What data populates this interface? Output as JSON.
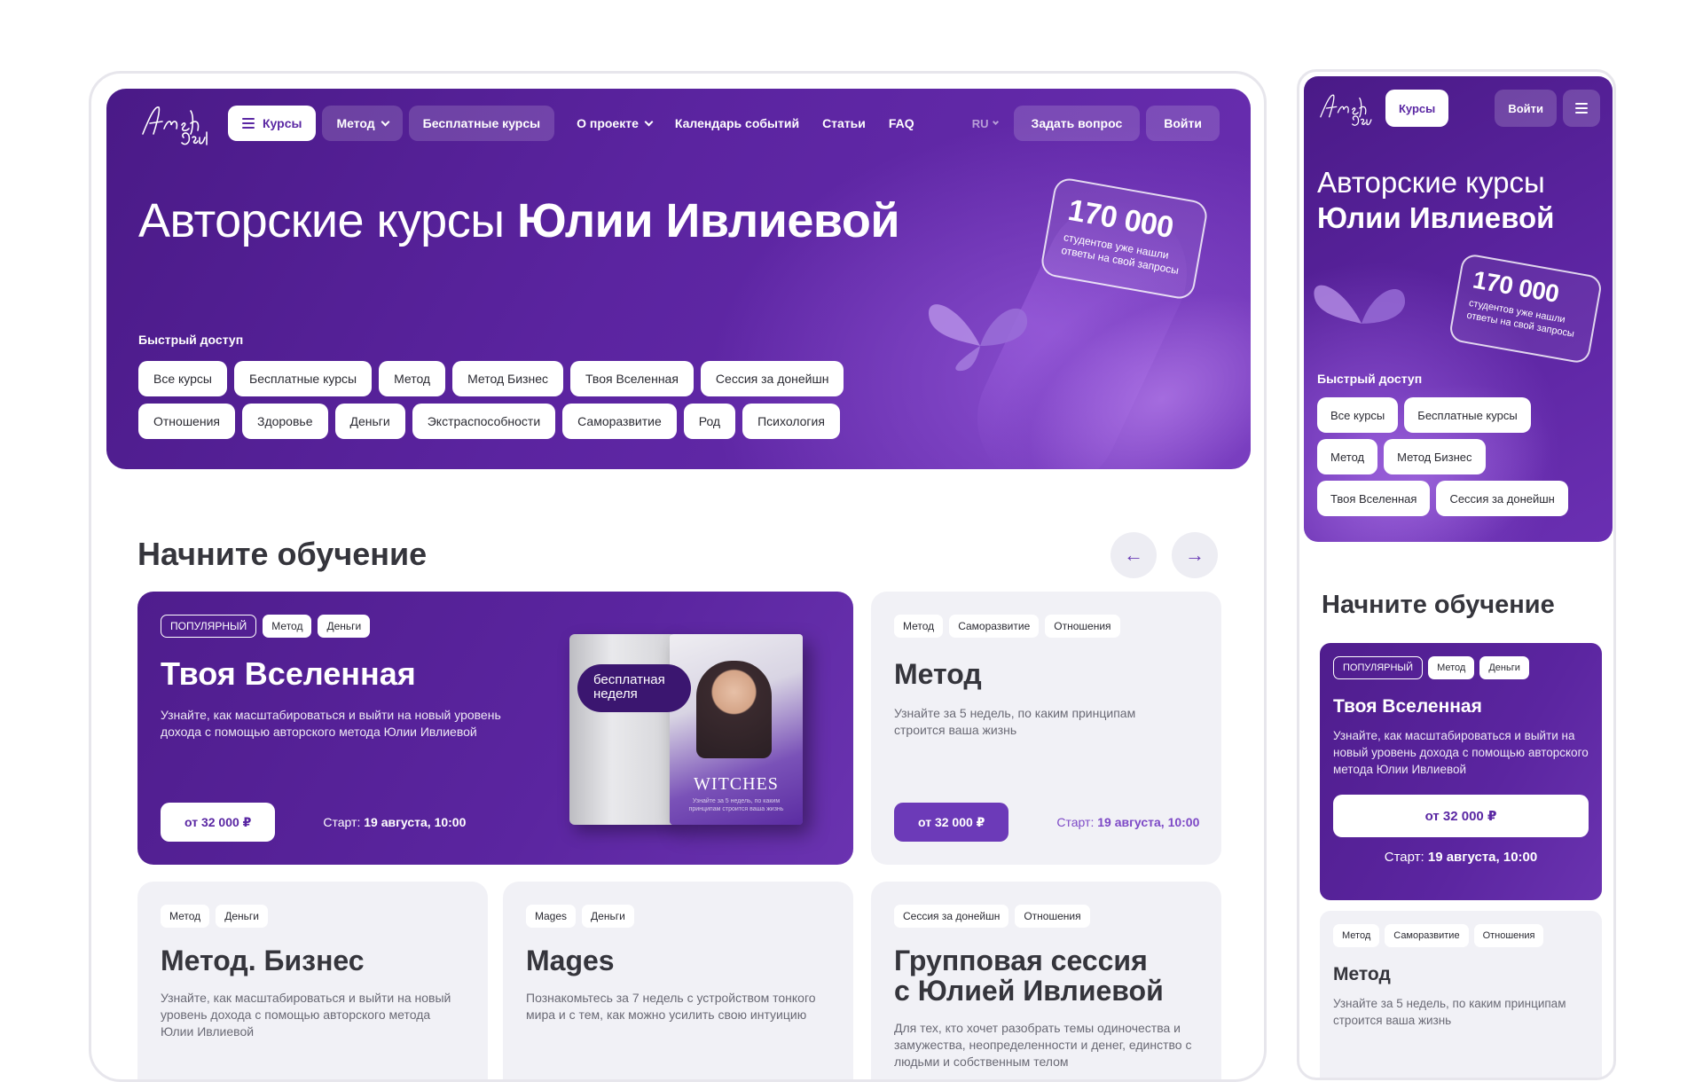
{
  "brand": {
    "logo_text": "Amsh Soul",
    "accent": "#5b24a0",
    "accent_light": "#7d49c6"
  },
  "nav": {
    "courses": "Курсы",
    "method": "Метод",
    "free_courses": "Бесплатные курсы",
    "about": "О проекте",
    "calendar": "Календарь событий",
    "articles": "Статьи",
    "faq": "FAQ",
    "lang": "RU",
    "ask": "Задать вопрос",
    "login": "Войти"
  },
  "hero": {
    "title_light": "Авторские курсы ",
    "title_bold": "Юлии Ивлиевой",
    "stat_number": "170 000",
    "stat_text": "студентов уже нашли ответы на свой запросы",
    "quick_access_label": "Быстрый доступ",
    "chips_row1": [
      "Все курсы",
      "Бесплатные курсы",
      "Метод",
      "Метод Бизнес",
      "Твоя Вселенная",
      "Сессия за донейшн"
    ],
    "chips_row2": [
      "Отношения",
      "Здоровье",
      "Деньги",
      "Экстраспособности",
      "Саморазвитие",
      "Род",
      "Психология"
    ]
  },
  "section": {
    "title": "Начните обучение",
    "prev_icon": "←",
    "next_icon": "→"
  },
  "cards": {
    "featured": {
      "badge": "ПОПУЛЯРНЫЙ",
      "tags": [
        "Метод",
        "Деньги"
      ],
      "title": "Твоя Вселенная",
      "desc": "Узнайте, как масштабироваться и выйти на новый уровень дохода с помощью авторского метода Юлии Ивлиевой",
      "price": "от 32 000 ₽",
      "start_label": "Старт: ",
      "start_value": "19 августа, 10:00",
      "book_badge": "бесплатная неделя",
      "book_title": "WITCHES",
      "book_caption": "Узнайте за 5 недель, по каким принципам строится ваша жизнь"
    },
    "method": {
      "tags": [
        "Метод",
        "Саморазвитие",
        "Отношения"
      ],
      "title": "Метод",
      "desc": "Узнайте за 5 недель, по каким принципам строится ваша жизнь",
      "price": "от 32 000 ₽",
      "start_label": "Старт: ",
      "start_value": "19 августа, 10:00"
    },
    "method_business": {
      "tags": [
        "Метод",
        "Деньги"
      ],
      "title": "Метод. Бизнес",
      "desc": "Узнайте, как масштабироваться и выйти на новый уровень дохода с помощью авторского метода Юлии Ивлиевой"
    },
    "mages": {
      "tags": [
        "Mages",
        "Деньги"
      ],
      "title": "Mages",
      "desc": "Познакомьтесь за 7 недель с устройством тонкого мира и с тем, как можно усилить свою интуицию"
    },
    "group_session": {
      "tags": [
        "Сессия за донейшн",
        "Отношения"
      ],
      "title_line1": "Групповая сессия",
      "title_line2": "с Юлией Ивлиевой",
      "desc": "Для тех, кто хочет разобрать темы одиночества и замужества, неопределенности и денег, единство с людьми и собственным телом"
    }
  },
  "mobile": {
    "courses": "Курсы",
    "login": "Войти",
    "title_light": "Авторские курсы",
    "title_bold": "Юлии Ивлиевой",
    "stat_number": "170 000",
    "stat_text": "студентов уже нашли ответы на свой запросы",
    "quick_access_label": "Быстрый доступ",
    "chips_row1": [
      "Все курсы",
      "Бесплатные курсы"
    ],
    "chips_row2": [
      "Метод",
      "Метод Бизнес"
    ],
    "chips_row3": [
      "Твоя Вселенная",
      "Сессия за донейшн"
    ],
    "section_title": "Начните обучение",
    "featured": {
      "badge": "ПОПУЛЯРНЫЙ",
      "tags": [
        "Метод",
        "Деньги"
      ],
      "title": "Твоя Вселенная",
      "desc": "Узнайте, как масштабироваться и выйти на новый уровень дохода с помощью авторского метода Юлии Ивлиевой",
      "price": "от 32 000 ₽",
      "start_label": "Старт: ",
      "start_value": "19 августа, 10:00"
    },
    "method": {
      "tags": [
        "Метод",
        "Саморазвитие",
        "Отношения"
      ],
      "title": "Метод",
      "desc": "Узнайте за 5 недель, по каким принципам строится ваша жизнь"
    }
  }
}
